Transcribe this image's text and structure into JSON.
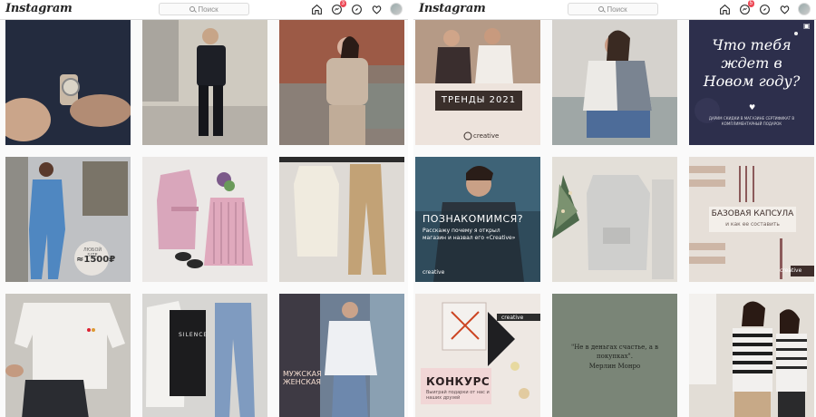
{
  "left": {
    "logo": "Instagram",
    "search_placeholder": "Поиск",
    "notif_count": "3",
    "tiles": [
      {
        "name": "man-dark-shirt-watch"
      },
      {
        "name": "man-black-outfit-street"
      },
      {
        "name": "woman-beige-knit-set"
      },
      {
        "name": "blue-jumpsuit-price-tag",
        "price_line1": "ЛЮБОЙ SIZE",
        "price": "≈1500₽"
      },
      {
        "name": "pink-blazer-skirt-flatlay"
      },
      {
        "name": "white-top-beige-pants"
      },
      {
        "name": "white-tshirt-shorts"
      },
      {
        "name": "denim-jacket-jeans-set",
        "shirt_text": "SILENCE"
      },
      {
        "name": "woman-graphic-tee-store",
        "sign_text": "МУЖСКАЯ ЖЕНСКАЯ"
      }
    ]
  },
  "right": {
    "logo": "Instagram",
    "search_placeholder": "Поиск",
    "notif_count": "5",
    "tiles": [
      {
        "name": "trends-2021",
        "label": "ТРЕНДЫ 2021",
        "brand": "creative"
      },
      {
        "name": "woman-shirt-jeans"
      },
      {
        "name": "new-year-question",
        "title": "Что тебя ждет в Новом году?",
        "subtitle": "ДАРИМ СКИДКИ В МАГАЗИНЕ СЕРТИФИКАТ В КОМПЛИМЕНТАРНЫЙ ПОДАРОК"
      },
      {
        "name": "lets-meet",
        "title": "ПОЗНАКОМИМСЯ?",
        "text": "Расскажу почему я открыл магазин и назвал его «Creative»",
        "brand": "creative"
      },
      {
        "name": "grey-hoodie-tree"
      },
      {
        "name": "base-capsule",
        "title": "БАЗОВАЯ КАПСУЛА",
        "subtitle": "и как ее составить",
        "brand": "creative"
      },
      {
        "name": "contest-gifts",
        "title": "КОНКУРС",
        "subtitle": "Выиграй подарки от нас и наших друзей",
        "brand": "creative"
      },
      {
        "name": "monroe-quote",
        "quote": "\"Не в деньгах счастье, а в покупках\".",
        "author": "Мерлин Монро"
      },
      {
        "name": "two-women-striped"
      }
    ]
  },
  "colors": {
    "notif": "#ed4956",
    "border": "#dbdbdb"
  }
}
